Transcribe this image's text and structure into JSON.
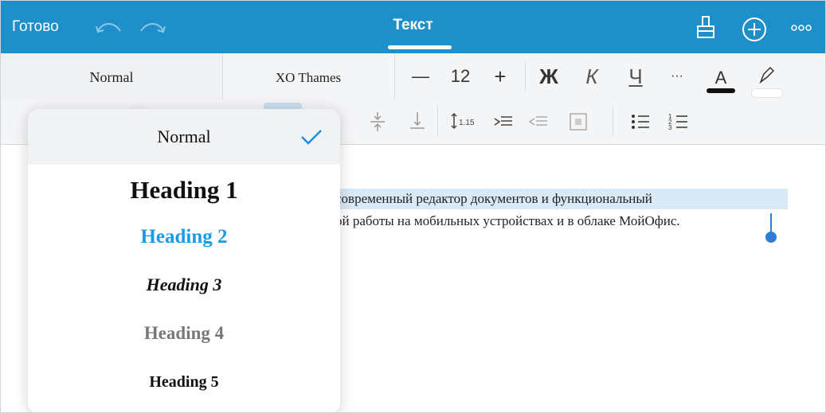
{
  "topbar": {
    "done_label": "Готово",
    "title": "Текст",
    "undo_icon": "undo-icon",
    "redo_icon": "redo-icon",
    "brush_icon": "format-brush-icon",
    "add_icon": "add-circle-icon",
    "more_icon": "more-dots-icon"
  },
  "toolbar": {
    "style_value": "Normal",
    "font_value": "XO Thames",
    "decrease_label": "—",
    "font_size": "12",
    "increase_label": "+",
    "bold_label": "Ж",
    "italic_label": "К",
    "underline_label": "Ч",
    "more_label": "···",
    "text_color_label": "A"
  },
  "document": {
    "line1": "современный  редактор  документов  и  функциональный",
    "line2": "ой работы на мобильных устройствах и в облаке МойОфис."
  },
  "style_menu": {
    "items": [
      {
        "label": "Normal"
      },
      {
        "label": "Heading 1"
      },
      {
        "label": "Heading 2"
      },
      {
        "label": "Heading 3"
      },
      {
        "label": "Heading 4"
      },
      {
        "label": "Heading 5"
      }
    ],
    "selected_index": 0
  },
  "colors": {
    "topbar": "#1f8fc9",
    "heading2": "#1a9be6",
    "heading4": "#777777",
    "accent": "#2b7fd8"
  }
}
